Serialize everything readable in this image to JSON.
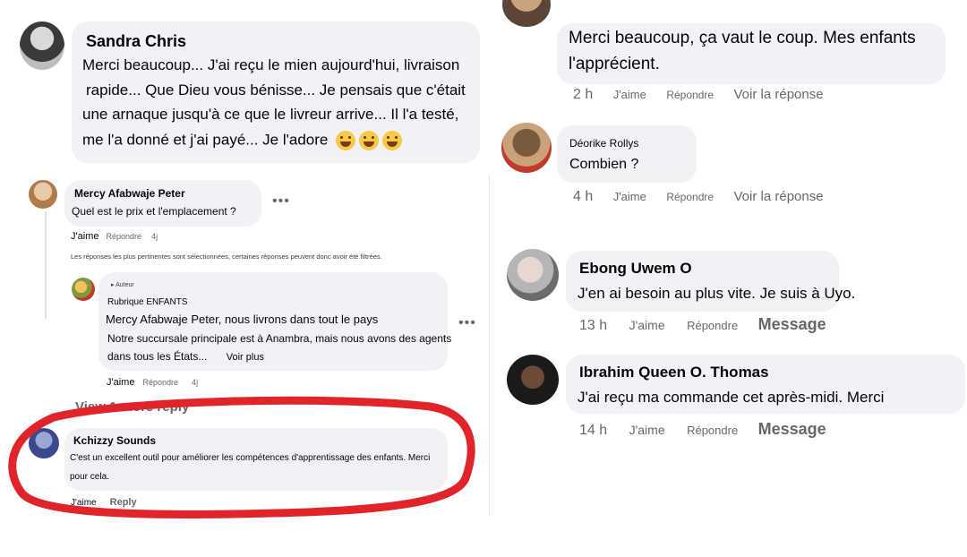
{
  "left": {
    "sandra": {
      "name": "Sandra Chris",
      "lines": [
        "Merci beaucoup... J'ai reçu le mien aujourd'hui, livraison",
        "rapide... Que Dieu vous bénisse... Je pensais que c'était",
        "une arnaque jusqu'à ce que le livreur arrive... Il l'a testé,",
        "me l'a donné et j'ai payé... Je l'adore"
      ]
    },
    "mercy": {
      "name": "Mercy Afabwaje Peter",
      "text": "Quel est le prix et l'emplacement ?",
      "like": "J'aime",
      "reply": "Répondre",
      "time": "4j"
    },
    "filter_note": "Les réponses les plus pertinentes sont sélectionnées, certaines réponses peuvent donc avoir été filtrées.",
    "page_reply": {
      "author_badge": "Auteur",
      "name": "Rubrique ENFANTS",
      "line1": "Mercy Afabwaje Peter, nous livrons dans tout le pays",
      "line2": "Notre succursale principale est à Anambra, mais nous avons des agents",
      "line3": "dans tous les États...",
      "see_more": "Voir plus",
      "like": "J'aime",
      "reply": "Répondre",
      "time": "4j",
      "view_more": "View 1 more reply"
    },
    "kchizzy": {
      "name": "Kchizzy Sounds",
      "line1": "C'est un excellent outil pour améliorer les compétences d'apprentissage des enfants. Merci",
      "line2": "pour cela.",
      "like": "J'aime",
      "reply": "Reply"
    }
  },
  "right": {
    "top_comment": {
      "line1": "Merci beaucoup, ça vaut le coup. Mes enfants",
      "line2": "l'apprécient.",
      "time": "2 h",
      "like": "J'aime",
      "reply": "Répondre",
      "see_reply": "Voir la réponse"
    },
    "deorike": {
      "name": "Déorike Rollys",
      "text": "Combien ?",
      "time": "4 h",
      "like": "J'aime",
      "reply": "Répondre",
      "see_reply": "Voir la réponse"
    },
    "ebong": {
      "name": "Ebong Uwem O",
      "text": "J'en ai besoin au plus vite. Je suis à Uyo.",
      "time": "13 h",
      "like": "J'aime",
      "reply": "Répondre",
      "message": "Message"
    },
    "ibrahim": {
      "name": "Ibrahim Queen O. Thomas",
      "text": "J'ai reçu ma commande cet après-midi. Merci",
      "time": "14 h",
      "like": "J'aime",
      "reply": "Répondre",
      "message": "Message"
    }
  },
  "colors": {
    "bubble": "#f0f2f5",
    "meta": "#65676b",
    "highlight": "#e0242a"
  }
}
